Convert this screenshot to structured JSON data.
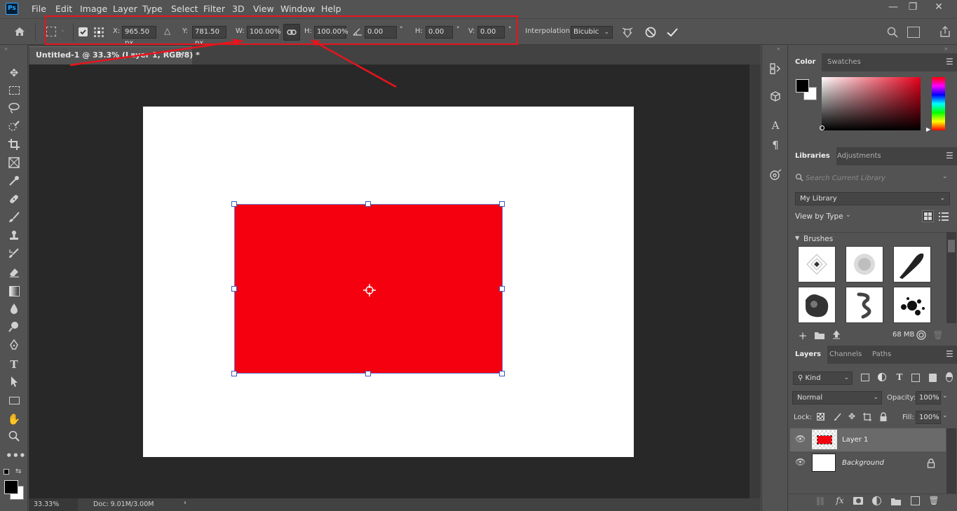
{
  "app": {
    "logo": "Ps"
  },
  "menu": [
    "File",
    "Edit",
    "Image",
    "Layer",
    "Type",
    "Select",
    "Filter",
    "3D",
    "View",
    "Window",
    "Help"
  ],
  "window_controls": {
    "minimize": "—",
    "restore": "❐",
    "close": "✕"
  },
  "options": {
    "x_label": "X:",
    "x_value": "965.50 px",
    "y_label": "Y:",
    "y_value": "781.50 px",
    "w_label": "W:",
    "w_value": "100.00%",
    "h_label": "H:",
    "h_value": "100.00%",
    "angle_value": "0.00",
    "hskew_label": "H:",
    "hskew_value": "0.00",
    "vskew_label": "V:",
    "vskew_value": "0.00",
    "degree": "°",
    "interpolation_label": "Interpolation:",
    "interpolation_value": "Bicubic"
  },
  "document": {
    "tab_title": "Untitled-1 @ 33.3% (Layer 1, RGB/8) *",
    "canvas_color": "#ffffff",
    "shape_color": "#f5000f"
  },
  "status": {
    "zoom": "33.33%",
    "doc_info": "Doc: 9.01M/3.00M"
  },
  "color_panel": {
    "tabs": [
      "Color",
      "Swatches"
    ],
    "foreground": "#000000",
    "background": "#ffffff"
  },
  "libraries_panel": {
    "tabs": [
      "Libraries",
      "Adjustments"
    ],
    "search_placeholder": "Search Current Library",
    "library_name": "My Library",
    "view_by": "View by Type",
    "section_title": "Brushes",
    "storage": "68 MB"
  },
  "layers_panel": {
    "tabs": [
      "Layers",
      "Channels",
      "Paths"
    ],
    "filter_kind": "Kind",
    "blend_mode": "Normal",
    "opacity_label": "Opacity:",
    "opacity_value": "100%",
    "lock_label": "Lock:",
    "fill_label": "Fill:",
    "fill_value": "100%",
    "layers": [
      {
        "name": "Layer 1",
        "selected": true,
        "locked": false
      },
      {
        "name": "Background",
        "selected": false,
        "locked": true
      }
    ]
  },
  "annotation_color": "#e8141c"
}
